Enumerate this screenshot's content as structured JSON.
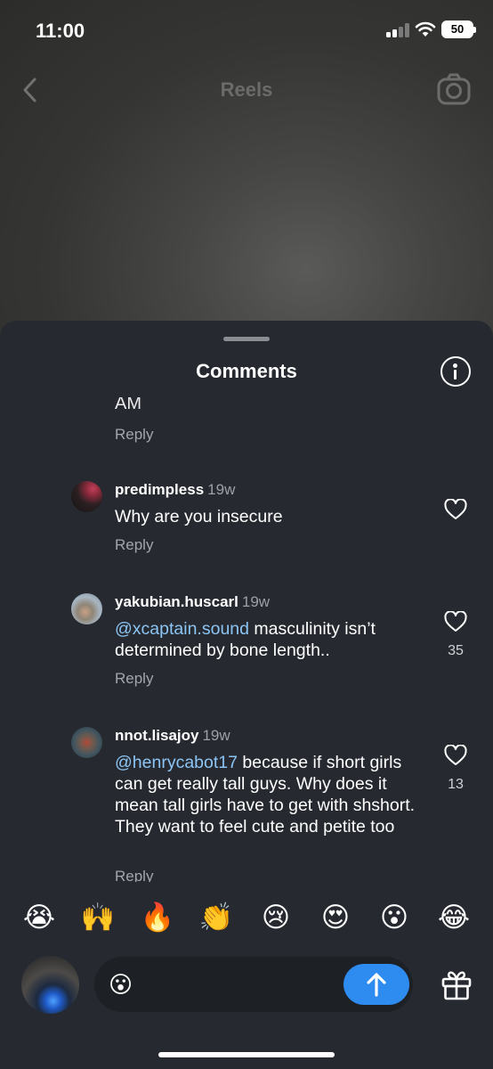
{
  "status_bar": {
    "time": "11:00",
    "battery": "50"
  },
  "reel_header": {
    "title": "Reels"
  },
  "sheet": {
    "title": "Comments",
    "cut_off_text": "AM",
    "reply_label": "Reply"
  },
  "comments": [
    {
      "username": "predimpless",
      "time": "19w",
      "mention": "",
      "text": "Why are you insecure",
      "likes": ""
    },
    {
      "username": "yakubian.huscarl",
      "time": "19w",
      "mention": "@xcaptain.sound",
      "text": " masculinity isn’t determined by bone length..",
      "likes": "35"
    },
    {
      "username": "nnot.lisajoy",
      "time": "19w",
      "mention": "@henrycabot17",
      "text": " because if short girls can get really tall guys. Why does it mean tall girls have to get with shshort. They want to feel cute and petite too",
      "likes": "13"
    }
  ],
  "emoji_bar": [
    "😭",
    "🙌",
    "🔥",
    "👏",
    "😢",
    "😍",
    "😮",
    "😂"
  ],
  "composer": {
    "emoji": "😮"
  },
  "colors": {
    "accent": "#2e8bf0",
    "mention": "#8cc5f5",
    "sheet": "#262a30"
  }
}
